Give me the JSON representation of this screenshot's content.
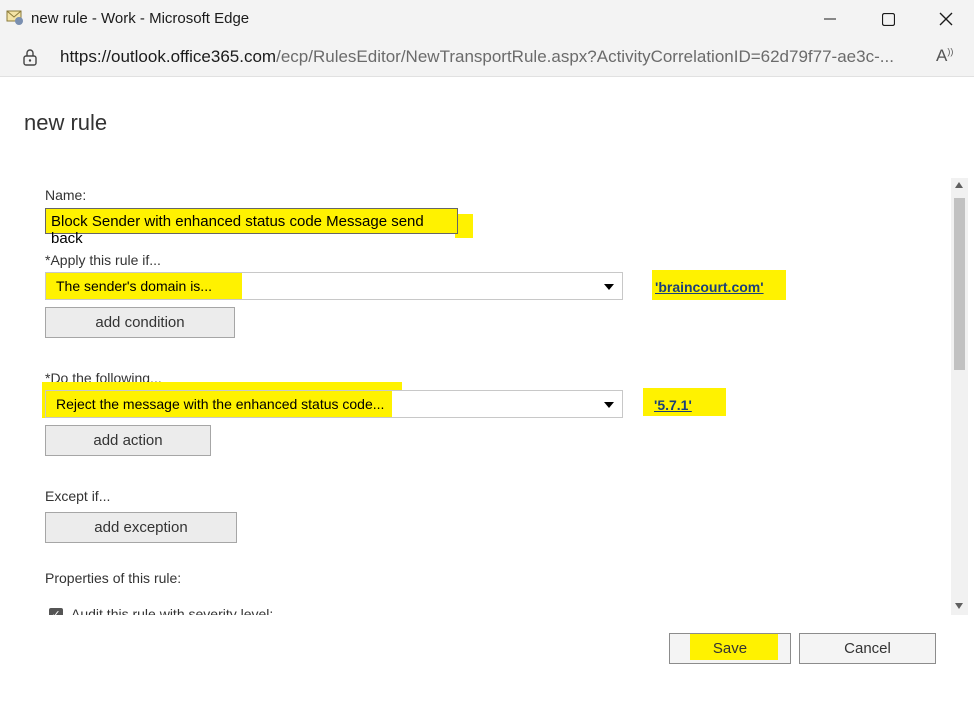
{
  "window": {
    "title": "new rule - Work - Microsoft Edge",
    "url_host": "https://outlook.office365.com",
    "url_path": "/ecp/RulesEditor/NewTransportRule.aspx?ActivityCorrelationID=62d79f77-ae3c-..."
  },
  "page": {
    "heading": "new rule"
  },
  "form": {
    "name_label": "Name:",
    "name_value": "Block Sender with enhanced status code Message send back",
    "apply_label": "*Apply this rule if...",
    "condition_value": "The sender's domain is...",
    "condition_link": "'braincourt.com'",
    "add_condition": "add condition",
    "do_label": "*Do the following...",
    "action_value": "Reject the message with the enhanced status code...",
    "action_link": "'5.7.1'",
    "add_action": "add action",
    "except_label": "Except if...",
    "add_exception": "add exception",
    "properties_label": "Properties of this rule:",
    "audit_label": "Audit this rule with severity level:"
  },
  "footer": {
    "save": "Save",
    "cancel": "Cancel"
  },
  "colors": {
    "highlight": "#fff200",
    "link": "#1a3f7a"
  }
}
